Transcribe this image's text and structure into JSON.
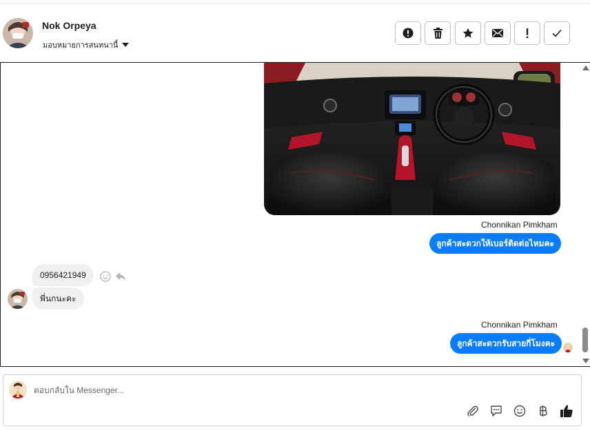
{
  "header": {
    "name": "Nok Orpeya",
    "assign_label": "มอบหมายการสนทนานี้",
    "toolbar": [
      {
        "icon": "alert-circle-icon",
        "name": "spam-button"
      },
      {
        "icon": "trash-icon",
        "name": "delete-button"
      },
      {
        "icon": "star-icon",
        "name": "star-button"
      },
      {
        "icon": "envelope-icon",
        "name": "mark-unread-button"
      },
      {
        "icon": "exclamation-icon",
        "name": "follow-up-button"
      },
      {
        "icon": "check-icon",
        "name": "done-button"
      }
    ]
  },
  "messages": {
    "sender_1": "Chonnikan Pimkham",
    "outgoing_1": "ลูกค้าสะดวกให้เบอร์ติดต่อไหมคะ",
    "incoming_1": "0956421949",
    "incoming_2": "พี่นกนะคะ",
    "sender_2": "Chonnikan Pimkham",
    "outgoing_2": "ลูกค้าสะดวกรับสายกี่โมงคะ"
  },
  "composer": {
    "placeholder": "ตอบกลับใน Messenger...",
    "tools": [
      "paperclip-icon",
      "chat-bubble-icon",
      "smiley-icon",
      "baht-icon",
      "thumbs-up-icon"
    ]
  },
  "colors": {
    "accent": "#0a7cff",
    "incoming_bubble": "#f0f0f0",
    "border": "#bcc0c4"
  }
}
